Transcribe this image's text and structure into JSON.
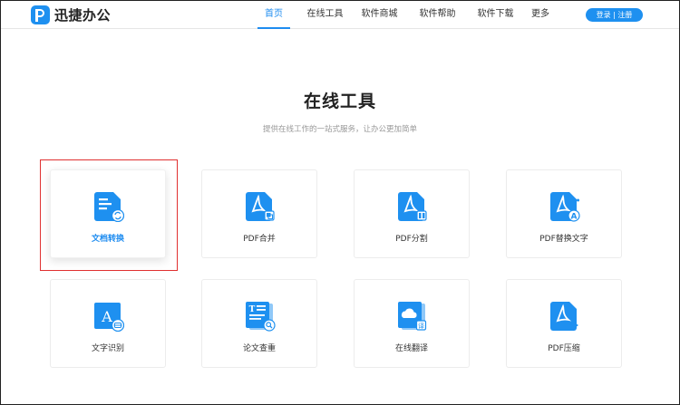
{
  "brand": {
    "name": "迅捷办公"
  },
  "nav": {
    "items": [
      {
        "label": "首页",
        "active": true
      },
      {
        "label": "在线工具"
      },
      {
        "label": "软件商城"
      },
      {
        "label": "软件帮助"
      },
      {
        "label": "软件下载"
      },
      {
        "label": "更多"
      }
    ],
    "login_label": "登录 | 注册"
  },
  "hero": {
    "title": "在线工具",
    "subtitle": "提供在线工作的一站式服务，让办公更加简单"
  },
  "tools": [
    {
      "label": "文档转换",
      "icon": "doc-convert-icon",
      "selected": true
    },
    {
      "label": "PDF合并",
      "icon": "pdf-merge-icon"
    },
    {
      "label": "PDF分割",
      "icon": "pdf-split-icon"
    },
    {
      "label": "PDF替换文字",
      "icon": "pdf-replace-text-icon"
    },
    {
      "label": "文字识别",
      "icon": "text-recognition-icon"
    },
    {
      "label": "论文查重",
      "icon": "paper-check-icon"
    },
    {
      "label": "在线翻译",
      "icon": "online-translate-icon"
    },
    {
      "label": "PDF压缩",
      "icon": "pdf-compress-icon"
    }
  ],
  "colors": {
    "accent": "#1e8cf0",
    "highlight": "#e03030"
  }
}
